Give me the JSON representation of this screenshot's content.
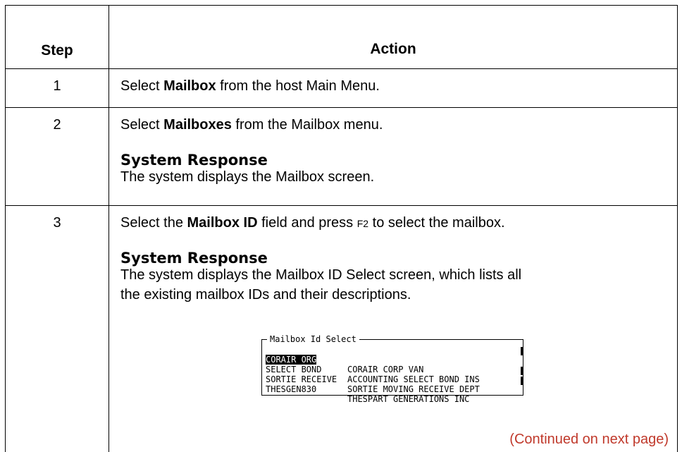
{
  "table": {
    "header_step": "Step",
    "header_action": "Action",
    "continued": "(Continued on next page)"
  },
  "rows": [
    {
      "step": "1",
      "pre": "Select ",
      "bold": "Mailbox",
      "post": " from the host Main Menu."
    },
    {
      "step": "2",
      "pre": "Select ",
      "bold": "Mailboxes",
      "post": " from the Mailbox menu.",
      "response_title": "System Response",
      "response_text": "The system displays the Mailbox screen."
    },
    {
      "step": "3",
      "pre": "Select the ",
      "bold": "Mailbox ID",
      "mid": " field and press ",
      "key": "F2",
      "post": " to select the mailbox.",
      "response_title": "System Response",
      "response_line1": "The system displays the Mailbox ID Select screen, which lists all",
      "response_line2": "the existing mailbox IDs and their descriptions."
    }
  ],
  "terminal": {
    "title": "Mailbox Id Select",
    "rows": [
      {
        "id": "CORAIR ORG",
        "desc": "CORAIR CORP VAN",
        "selected": true
      },
      {
        "id": "SELECT BOND",
        "desc": "ACCOUNTING SELECT BOND INS",
        "selected": false
      },
      {
        "id": "SORTIE RECEIVE",
        "desc": "SORTIE MOVING RECEIVE DEPT",
        "selected": false
      },
      {
        "id": "THESGEN830",
        "desc": "THESPART GENERATIONS INC",
        "selected": false
      }
    ]
  }
}
